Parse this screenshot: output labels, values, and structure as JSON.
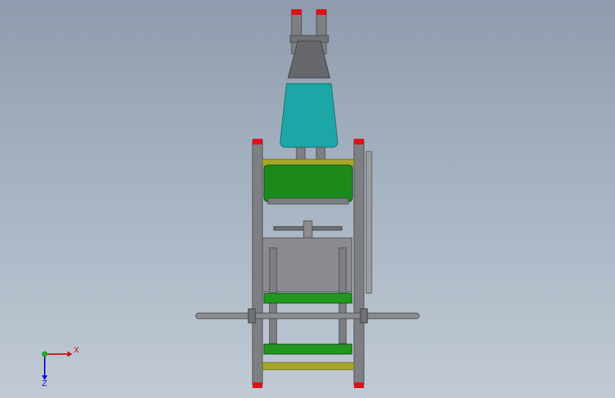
{
  "viewport": {
    "background_top": "#8e9cad",
    "background_bottom": "#c1cad5"
  },
  "model": {
    "colors": {
      "frame": "#7d7f82",
      "frame_dark": "#4a4c4f",
      "cap": "#e0101a",
      "backrest": "#1ca6a6",
      "headrest": "#66686b",
      "seat": "#1b8a1b",
      "olive": "#a8a62a",
      "green_bar": "#22961e",
      "plate": "#8a8c8f"
    }
  },
  "triad": {
    "x_label": "X",
    "z_label": "Z",
    "x_color": "#cc1111",
    "y_color": "#22aa22",
    "z_color": "#1111cc"
  }
}
